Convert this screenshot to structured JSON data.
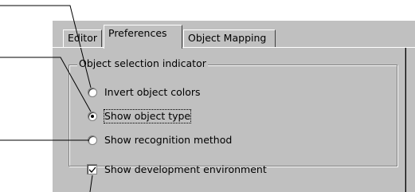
{
  "tabs": [
    {
      "label": "Editor",
      "active": false
    },
    {
      "label": "Preferences",
      "active": true
    },
    {
      "label": "Object Mapping",
      "active": false
    }
  ],
  "group": {
    "legend": "Object selection indicator",
    "radios": [
      {
        "label": "Invert object colors",
        "selected": false
      },
      {
        "label": "Show object type",
        "selected": true
      },
      {
        "label": "Show recognition method",
        "selected": false
      }
    ]
  },
  "checkbox": {
    "label": "Show development environment",
    "checked": true
  },
  "colors": {
    "face": "#c0c0c0",
    "highlight": "#ffffff",
    "shadow": "#808080",
    "dark": "#000000"
  }
}
